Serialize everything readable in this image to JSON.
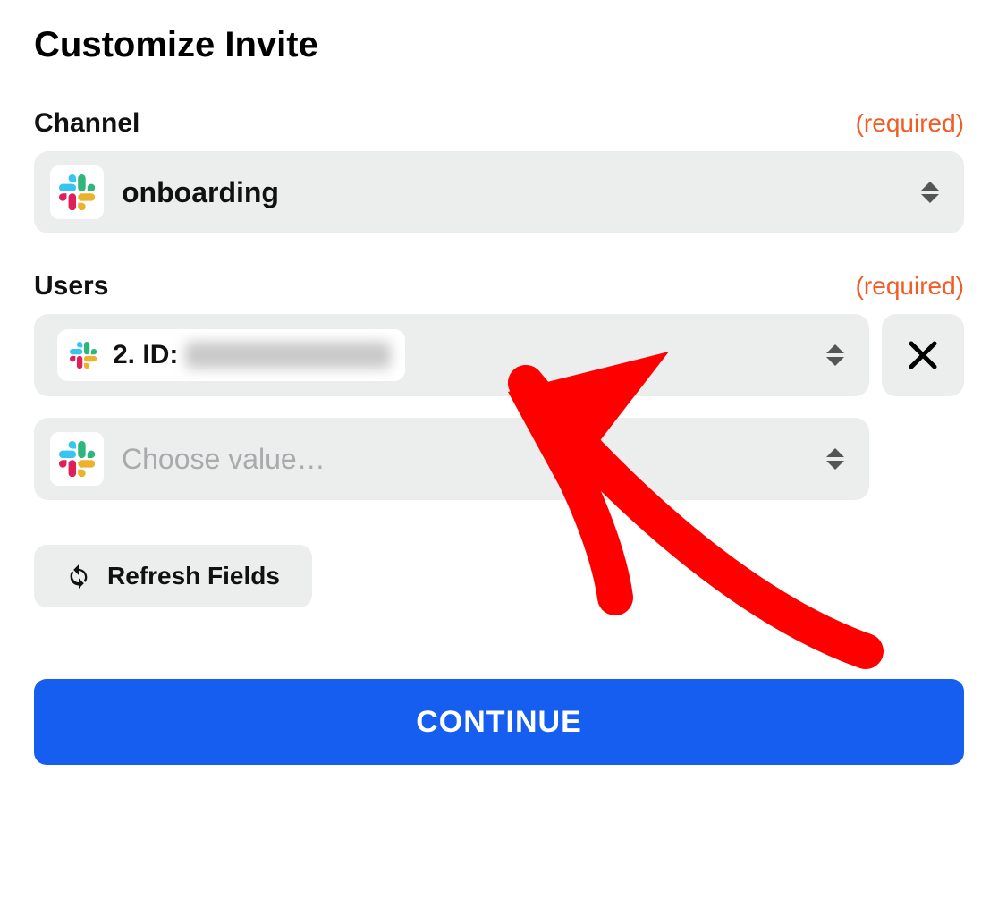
{
  "title": "Customize Invite",
  "required_label": "(required)",
  "channel": {
    "label": "Channel",
    "value": "onboarding"
  },
  "users": {
    "label": "Users",
    "selected_prefix": "2. ID:",
    "placeholder": "Choose value…"
  },
  "refresh_label": "Refresh Fields",
  "continue_label": "CONTINUE"
}
